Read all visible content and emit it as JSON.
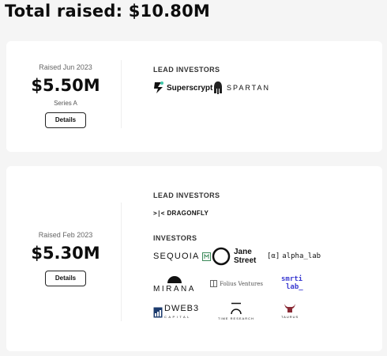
{
  "header": {
    "title": "Total raised: $10.80M"
  },
  "rounds": [
    {
      "raised_label": "Raised Jun 2023",
      "amount": "$5.50M",
      "series": "Series A",
      "details_label": "Details",
      "lead_investors_label": "LEAD INVESTORS",
      "lead_investors": [
        {
          "name": "Superscrypt",
          "icon": "superscrypt-logo"
        },
        {
          "name": "SPARTAN",
          "icon": "spartan-helmet-logo"
        }
      ]
    },
    {
      "raised_label": "Raised Feb 2023",
      "amount": "$5.30M",
      "details_label": "Details",
      "lead_investors_label": "LEAD INVESTORS",
      "lead_investors": [
        {
          "name": "DRAGONFLY",
          "mark": ">|<",
          "icon": "dragonfly-logo"
        }
      ],
      "investors_label": "INVESTORS",
      "investors": [
        {
          "name": "SEQUOIA",
          "icon": "sequoia-logo"
        },
        {
          "name": "Jane",
          "name2": "Street",
          "icon": "jane-street-logo"
        },
        {
          "name": "alpha_lab",
          "mark": "[α]",
          "icon": "alpha-lab-logo"
        },
        {
          "name": "MIRANA",
          "icon": "mirana-logo"
        },
        {
          "name": "Folius Ventures",
          "icon": "folius-ventures-logo"
        },
        {
          "name": "smrti",
          "name2": "lab_",
          "icon": "smrti-lab-logo"
        },
        {
          "name": "DWEB3",
          "sub": "CAPITAL",
          "icon": "dweb3-capital-logo"
        },
        {
          "name": "TIME RESEARCH",
          "icon": "time-research-logo"
        },
        {
          "name": "TAURUS",
          "icon": "taurus-logo"
        }
      ]
    }
  ],
  "colors": {
    "background": "#f5f5f5",
    "card": "#ffffff",
    "text": "#111111",
    "smrti": "#3b3bd1",
    "taurus": "#8a2a35",
    "sequoia_badge": "#3c8a5a"
  }
}
